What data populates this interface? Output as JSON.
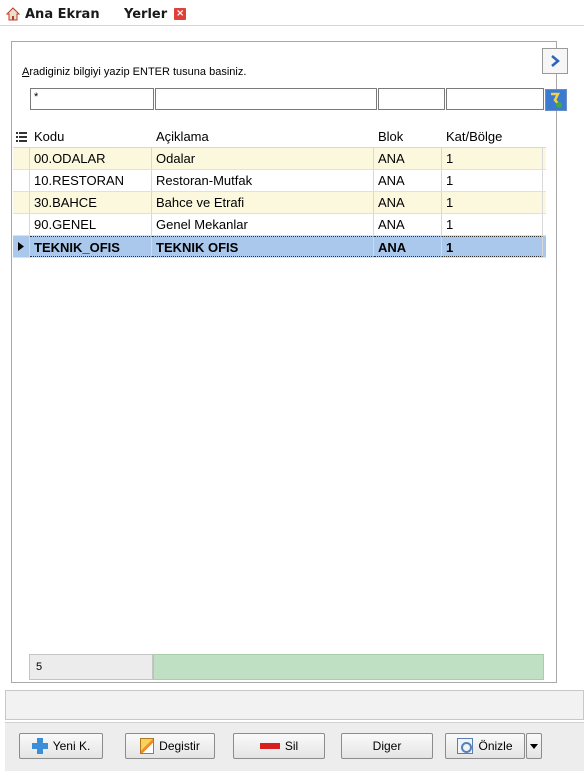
{
  "tabs": [
    {
      "label": "Ana Ekran",
      "icon": "home-icon"
    },
    {
      "label": "Yerler",
      "icon": "close-icon",
      "active": true
    }
  ],
  "search": {
    "hint_prefix": "A",
    "hint_rest": "radiginiz bilgiyi yazip ENTER tusuna basiniz.",
    "filter_values": [
      "*",
      "",
      "",
      ""
    ]
  },
  "grid": {
    "columns": [
      "Kodu",
      "Açiklama",
      "Blok",
      "Kat/Bölge"
    ],
    "rows": [
      {
        "kodu": "00.ODALAR",
        "aciklama": "Odalar",
        "blok": "ANA",
        "kat": "1"
      },
      {
        "kodu": "10.RESTORAN",
        "aciklama": "Restoran-Mutfak",
        "blok": "ANA",
        "kat": "1"
      },
      {
        "kodu": "30.BAHCE",
        "aciklama": "Bahce ve Etrafi",
        "blok": "ANA",
        "kat": "1"
      },
      {
        "kodu": "90.GENEL",
        "aciklama": "Genel Mekanlar",
        "blok": "ANA",
        "kat": "1"
      },
      {
        "kodu": "TEKNIK_OFIS",
        "aciklama": "TEKNIK OFIS",
        "blok": "ANA",
        "kat": "1"
      }
    ],
    "selected_index": 4,
    "record_count": "5"
  },
  "toolbar": {
    "new_label": "Yeni K.",
    "edit_label": "Degistir",
    "delete_label": "Sil",
    "other_label": "Diger",
    "preview_label": "Önizle"
  },
  "colors": {
    "alt_row": "#fbf8de",
    "selected_row": "#a9c8ec",
    "footer_fill": "#bfe0c2",
    "close_tab": "#e0403a"
  }
}
